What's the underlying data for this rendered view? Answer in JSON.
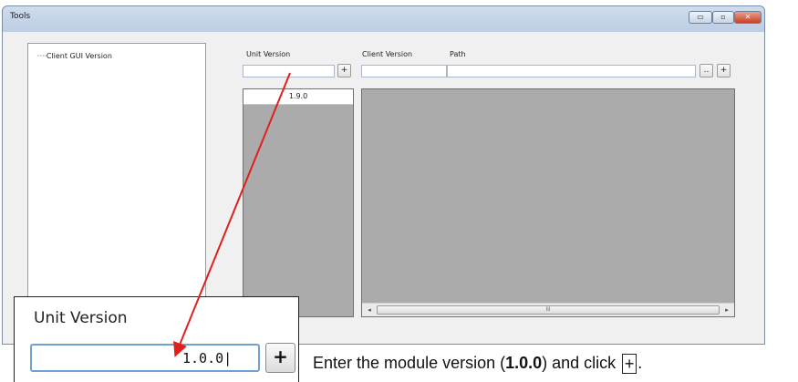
{
  "window": {
    "title": "Tools",
    "min_glyph": "▭",
    "max_glyph": "▫",
    "close_glyph": "✕"
  },
  "tree": {
    "item": "Client GUI Version"
  },
  "labels": {
    "unit_version": "Unit Version",
    "client_version": "Client Version",
    "path": "Path"
  },
  "inputs": {
    "unit_version_value": "",
    "client_version_value": "",
    "path_value": ""
  },
  "buttons": {
    "add": "+",
    "browse": "..",
    "add_path": "+"
  },
  "versions_list": [
    "1.9.0"
  ],
  "scrollbar": {
    "left": "◂",
    "right": "▸",
    "grip": "III"
  },
  "zoom": {
    "label": "Unit Version",
    "value": "1.0.0|",
    "plus": "+"
  },
  "instruction": {
    "prefix": "Enter the module version (",
    "bold": "1.0.0",
    "middle": ") and click ",
    "plus": "+",
    "suffix": "."
  },
  "colors": {
    "arrow": "#e0201c",
    "accent": "#6fa0d0"
  }
}
